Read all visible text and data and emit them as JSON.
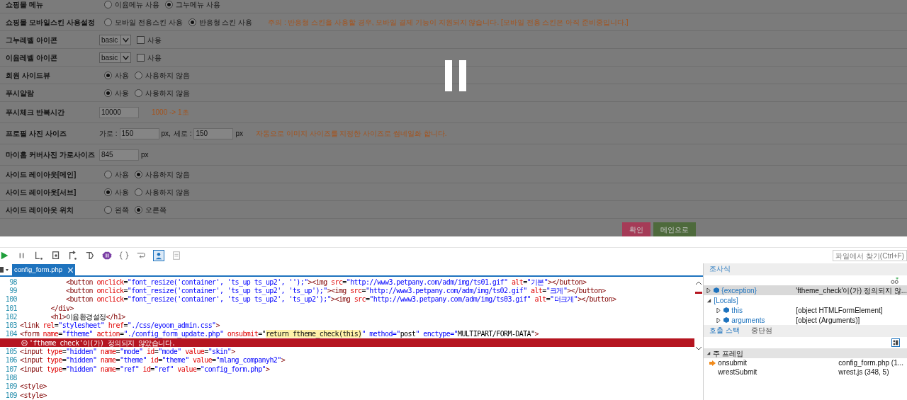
{
  "form": {
    "rows": [
      {
        "label": "쇼핑몰 메뉴",
        "kind": "radio",
        "options": [
          {
            "label": "이윰메뉴 사용",
            "selected": false
          },
          {
            "label": "그누메뉴 사용",
            "selected": true
          }
        ]
      },
      {
        "label": "쇼핑몰 모바일스킨 사용설정",
        "kind": "radio",
        "options": [
          {
            "label": "모바일 전용스킨 사용",
            "selected": false
          },
          {
            "label": "반응형 스킨 사용",
            "selected": true
          }
        ],
        "note": "주의 : 반응형 스킨을 사용할 경우, 모바일 결제 기능이 지원되지 않습니다. [모바일 전용 스킨은 아직 준비중입니다.]"
      },
      {
        "label": "그누레벨 아이콘",
        "kind": "select",
        "value": "basic",
        "checkbox": {
          "label": "사용",
          "checked": false
        }
      },
      {
        "label": "이윰레벨 아이콘",
        "kind": "select",
        "value": "basic",
        "checkbox": {
          "label": "사용",
          "checked": false
        }
      },
      {
        "label": "회원 사이드뷰",
        "kind": "radio",
        "options": [
          {
            "label": "사용",
            "selected": true
          },
          {
            "label": "사용하지 않음",
            "selected": false
          }
        ]
      },
      {
        "label": "푸시알람",
        "kind": "radio",
        "options": [
          {
            "label": "사용",
            "selected": true
          },
          {
            "label": "사용하지 않음",
            "selected": false
          }
        ]
      },
      {
        "label": "푸시체크 반복시간",
        "kind": "text",
        "fields": [
          {
            "value": "10000"
          }
        ],
        "note": "1000 -> 1초"
      },
      {
        "label": "프로필 사진 사이즈",
        "kind": "text",
        "fields": [
          {
            "prefix": "가로 :",
            "value": "150",
            "suffix": "px,"
          },
          {
            "prefix": "세로 :",
            "value": "150",
            "suffix": "px"
          }
        ],
        "note": "자동으로 이미지 사이즈를 지정한 사이즈로 썸네일화 합니다."
      },
      {
        "label": "마이홈 커버사진 가로사이즈",
        "kind": "text",
        "fields": [
          {
            "value": "845",
            "suffix": "px"
          }
        ]
      },
      {
        "label": "사이드 레이아웃[메인]",
        "kind": "radio",
        "options": [
          {
            "label": "사용",
            "selected": false
          },
          {
            "label": "사용하지 않음",
            "selected": true
          }
        ]
      },
      {
        "label": "사이드 레이아웃[서브]",
        "kind": "radio",
        "options": [
          {
            "label": "사용",
            "selected": true
          },
          {
            "label": "사용하지 않음",
            "selected": false
          }
        ]
      },
      {
        "label": "사이드 레이아웃 위치",
        "kind": "radio",
        "options": [
          {
            "label": "왼쪽",
            "selected": false
          },
          {
            "label": "오른쪽",
            "selected": true
          }
        ]
      }
    ],
    "buttons": [
      {
        "label": "확인",
        "kind": "confirm"
      },
      {
        "label": "메인으로",
        "kind": "main"
      }
    ]
  },
  "debugger": {
    "find": {
      "placeholder": "파일에서 찾기(Ctrl+F)"
    },
    "tab": {
      "label": "config_form.php"
    },
    "code": [
      {
        "number": "98",
        "parts": [
          {
            "text": "            <button onclick=\"font_resize('container', 'ts_up ts_up2', '');\"><img src=\"http://www3.petpany.com/adm/img/ts01.gif\" alt=\"기본\"></button>",
            "highlighted": false
          }
        ]
      },
      {
        "number": "99",
        "parts": [
          {
            "text": "            <button onclick=\"font_resize('container', 'ts_up ts_up2', 'ts_up');\"><img src=\"http://www3.petpany.com/adm/img/ts02.gif\" alt=\"크게\"></button>",
            "highlighted": false
          }
        ]
      },
      {
        "number": "100",
        "parts": [
          {
            "text": "            <button onclick=\"font_resize('container', 'ts_up ts_up2', 'ts_up2');\"><img src=\"http://www3.petpany.com/adm/img/ts03.gif\" alt=\"더크게\"></button>",
            "highlighted": false
          }
        ]
      },
      {
        "number": "101",
        "parts": [
          {
            "text": "        </div>",
            "highlighted": false
          }
        ]
      },
      {
        "number": "102",
        "parts": [
          {
            "text": "        <h1>이윰환경설정</h1>",
            "highlighted": false
          }
        ]
      },
      {
        "number": "103",
        "parts": [
          {
            "text": "<link rel=\"stylesheet\" href=\"./css/eyoom_admin.css\">",
            "highlighted": false
          }
        ]
      },
      {
        "number": "104",
        "parts": [
          {
            "text": "<form name=\"ftheme\" action=\"./config_form_update.php\" onsubmit=\"",
            "highlighted": false
          },
          {
            "text": "return ftheme_check(this)",
            "highlighted": true
          },
          {
            "text": "\" method=\"post\" enctype=\"MULTIPART/FORM-DATA\">",
            "highlighted": false
          }
        ],
        "error": "'ftheme_check'이(가) 정의되지 않았습니다."
      },
      {
        "number": "105",
        "parts": [
          {
            "text": "<input type=\"hidden\" name=\"mode\" id=\"mode\" value=\"skin\">",
            "highlighted": false
          }
        ]
      },
      {
        "number": "106",
        "parts": [
          {
            "text": "<input type=\"hidden\" name=\"theme\" id=\"theme\" value=\"mlang_companyh2\">",
            "highlighted": false
          }
        ]
      },
      {
        "number": "107",
        "parts": [
          {
            "text": "<input type=\"hidden\" name=\"ref\" id=\"ref\" value=\"config_form.php\">",
            "highlighted": false
          }
        ]
      },
      {
        "number": "108"
      },
      {
        "number": "109",
        "parts": [
          {
            "text": "<style>",
            "highlighted": false
          }
        ]
      },
      {
        "number": "109",
        "parts": [
          {
            "text": "<style>",
            "highlighted": false
          }
        ]
      }
    ],
    "watch": {
      "title": "조사식",
      "items": [
        {
          "name": "{exception}",
          "value": "'ftheme_check'이(가) 정의되지 않...",
          "expanded": false,
          "selected": true
        },
        {
          "name": "[Locals]",
          "expanded": true,
          "selected": false,
          "children": [
            {
              "name": "this",
              "value": "[object HTMLFormElement]",
              "expanded": false,
              "selected": false
            },
            {
              "name": "arguments",
              "value": "[object (Arguments)]",
              "expanded": false,
              "selected": false
            }
          ]
        }
      ]
    },
    "panel_tabs": [
      {
        "label": "호출 스택",
        "selected": true
      },
      {
        "label": "중단점",
        "selected": false
      }
    ],
    "call_stack": {
      "group": "주 프레임",
      "frames": [
        {
          "name": "onsubmit",
          "location": "config_form.php (1...",
          "current": true
        },
        {
          "name": "wrestSubmit",
          "location": "wrest.js (348, 5)",
          "current": false
        }
      ]
    }
  }
}
